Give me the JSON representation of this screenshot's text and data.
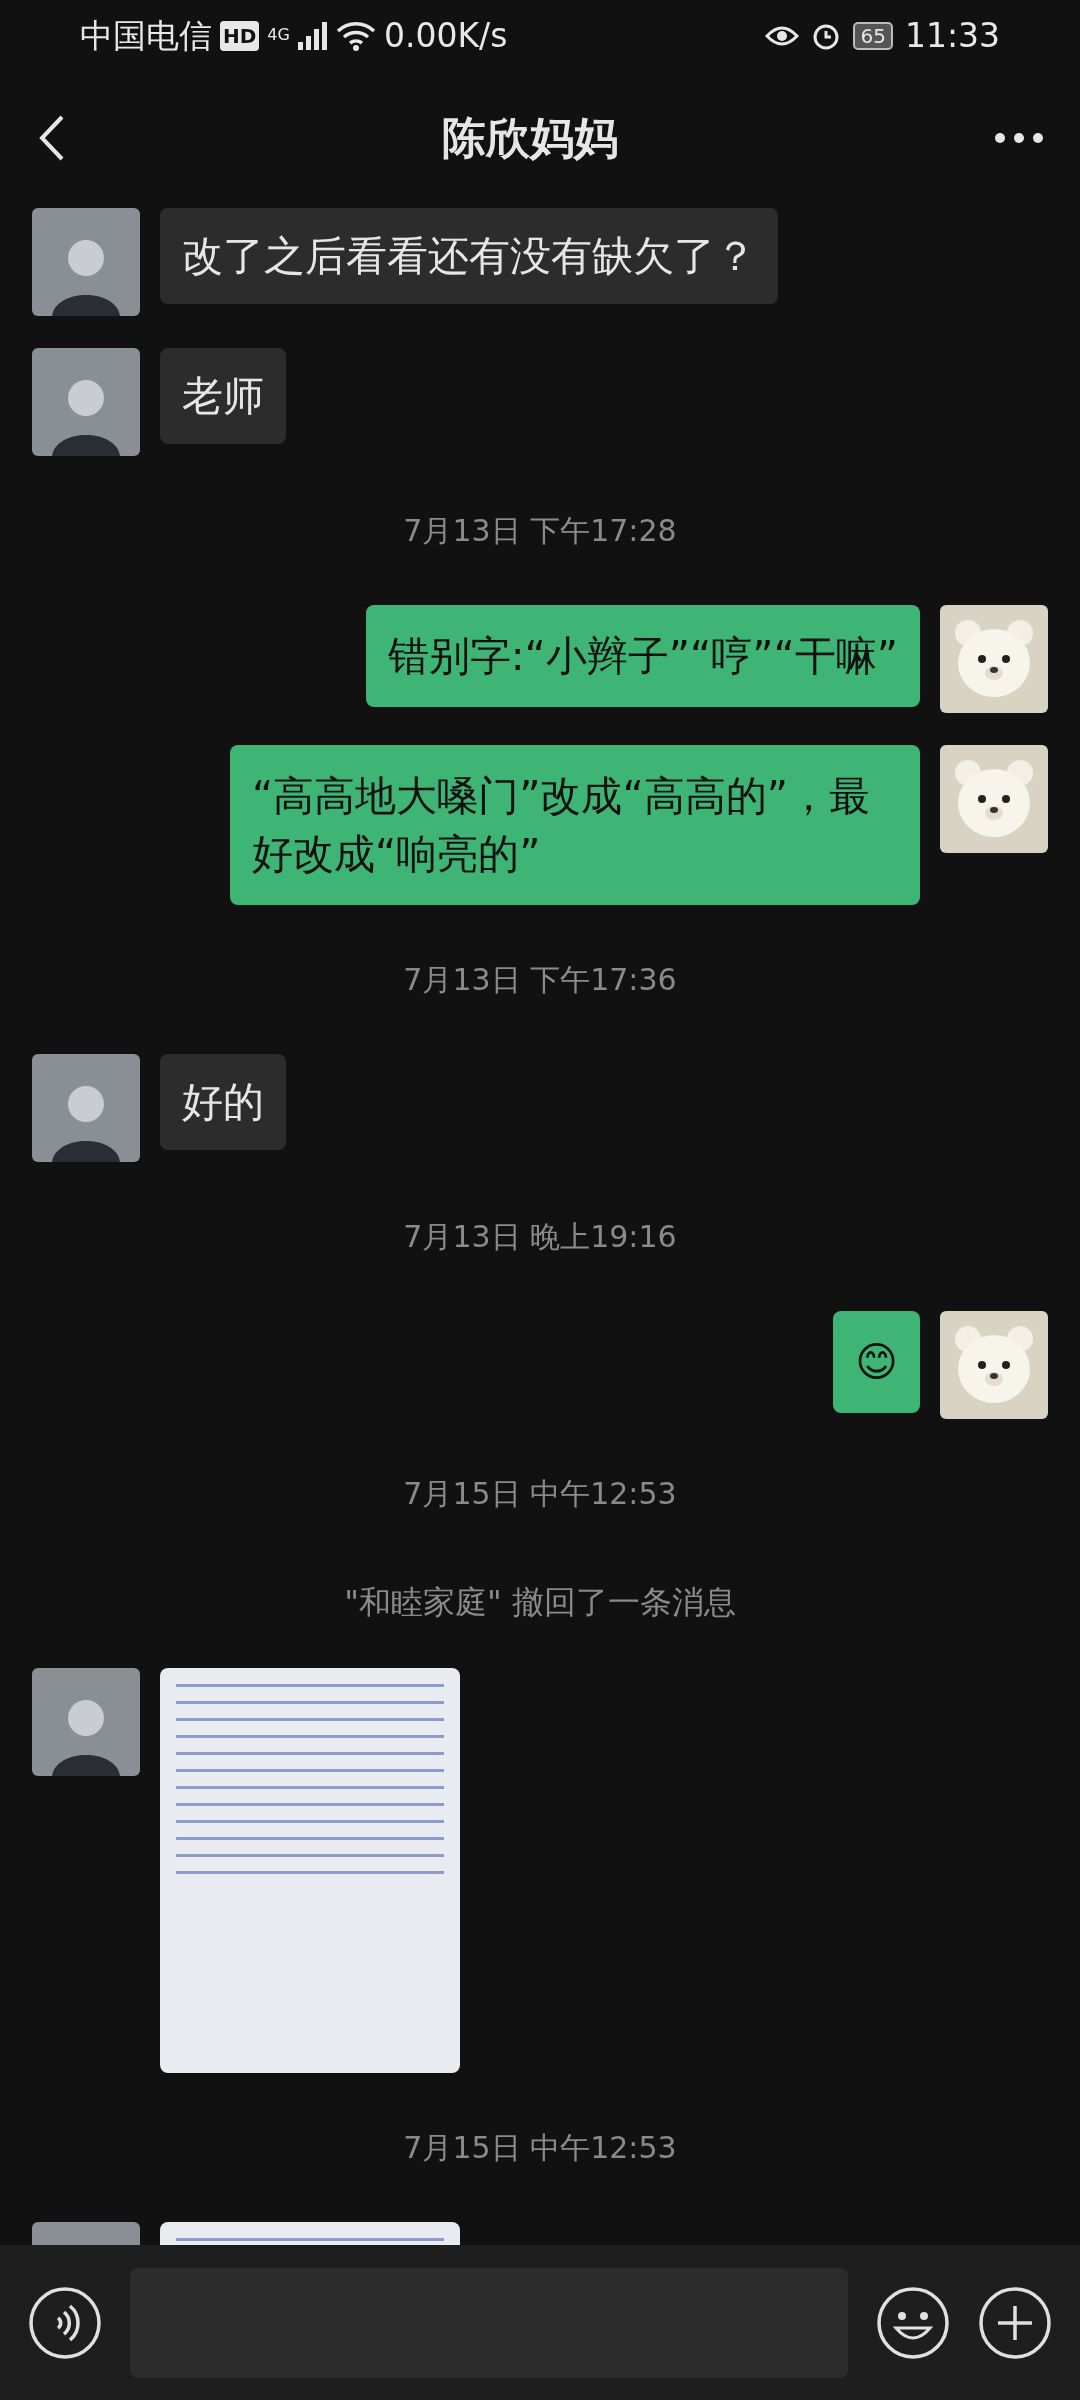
{
  "status_bar": {
    "carrier": "中国电信",
    "hd": "HD",
    "network": "4G",
    "speed": "0.00K/s",
    "battery": "65",
    "time": "11:33"
  },
  "header": {
    "title": "陈欣妈妈"
  },
  "messages": [
    {
      "kind": "received_text",
      "text": "改了之后看看还有没有缺欠了？"
    },
    {
      "kind": "received_text",
      "text": "老师"
    },
    {
      "kind": "time",
      "text": "7月13日 下午17:28"
    },
    {
      "kind": "sent_text",
      "text": "错别字:“小辫子”“哼”“干嘛”"
    },
    {
      "kind": "sent_text",
      "text": "“高高地大嗓门”改成“高高的”，最好改成“响亮的”"
    },
    {
      "kind": "time",
      "text": "7月13日 下午17:36"
    },
    {
      "kind": "received_text",
      "text": "好的"
    },
    {
      "kind": "time",
      "text": "7月13日 晚上19:16"
    },
    {
      "kind": "sent_text",
      "text": "😊"
    },
    {
      "kind": "time",
      "text": "7月15日 中午12:53"
    },
    {
      "kind": "recall",
      "text": "\"和睦家庭\" 撤回了一条消息"
    },
    {
      "kind": "received_image"
    },
    {
      "kind": "time",
      "text": "7月15日 中午12:53"
    },
    {
      "kind": "received_image"
    }
  ]
}
